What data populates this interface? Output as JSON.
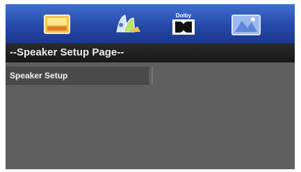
{
  "toolbar": {
    "icons": [
      {
        "name": "general-setup-icon"
      },
      {
        "name": "audio-setup-icon"
      },
      {
        "name": "dolby-icon",
        "text": "Dolby"
      },
      {
        "name": "preference-setup-icon"
      }
    ],
    "selected_index": 3,
    "colors": {
      "bar": "#2447a6",
      "selected": "#7f9fe6"
    }
  },
  "page": {
    "title": "--Speaker Setup Page--"
  },
  "menu": {
    "items": [
      {
        "label": "Speaker Setup",
        "selected": true
      }
    ]
  }
}
